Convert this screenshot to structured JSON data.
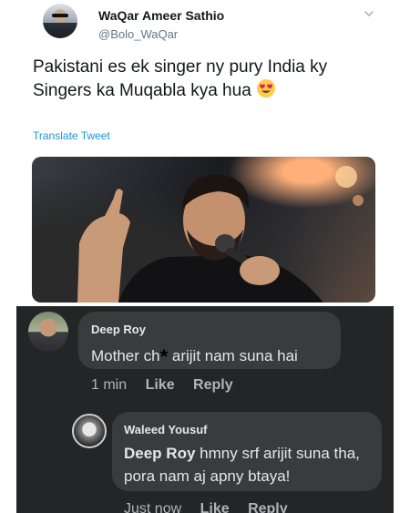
{
  "tweet": {
    "author_name": "WaQar Ameer Sathio",
    "author_handle": "@Bolo_WaQar",
    "text": "Pakistani es ek singer ny pury India ky Singers ka Muqabla kya hua",
    "emoji": "heart-eyes-emoji",
    "translate_label": "Translate Tweet",
    "image_alt": "singer-photo"
  },
  "comments": [
    {
      "name": "Deep Roy",
      "text_before": "Mother ch",
      "censor": "*",
      "text_after": " arijit nam suna hai",
      "time": "1 min",
      "like_label": "Like",
      "reply_label": "Reply"
    },
    {
      "name": "Waleed Yousuf",
      "tag": "Deep Roy",
      "text": " hmny srf arijit suna tha, pora nam aj apny btaya!",
      "time": "Just now",
      "like_label": "Like",
      "reply_label": "Reply"
    }
  ],
  "colors": {
    "twitter_link": "#1b95e0",
    "fb_background": "#242526",
    "fb_bubble": "#3a3b3c"
  }
}
